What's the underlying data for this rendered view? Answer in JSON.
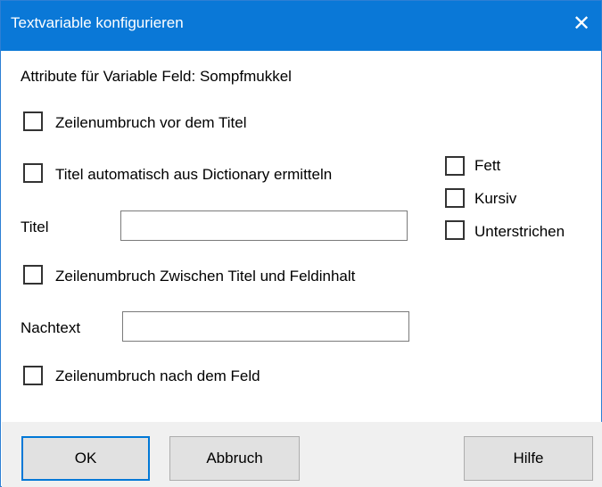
{
  "window": {
    "title": "Textvariable konfigurieren",
    "close_glyph": "✕",
    "colors": {
      "titlebar": "#0a78d7",
      "footer": "#f0f0f0",
      "accent": "#0078d7"
    }
  },
  "header": {
    "attribute_label": "Attribute für Variable Feld: Sompfmukkel"
  },
  "options": {
    "line_break_before_title": {
      "label": "Zeilenumbruch vor dem Titel",
      "checked": false
    },
    "auto_title_dictionary": {
      "label": "Titel automatisch aus Dictionary ermitteln",
      "checked": false
    },
    "line_break_between": {
      "label": "Zeilenumbruch Zwischen Titel und Feldinhalt",
      "checked": false
    },
    "line_break_after_field": {
      "label": "Zeilenumbruch nach dem Feld",
      "checked": false
    }
  },
  "style": {
    "bold": {
      "label": "Fett",
      "checked": false
    },
    "italic": {
      "label": "Kursiv",
      "checked": false
    },
    "underline": {
      "label": "Unterstrichen",
      "checked": false
    }
  },
  "fields": {
    "title_label": "Titel",
    "title_value": "",
    "posttext_label": "Nachtext",
    "posttext_value": ""
  },
  "buttons": {
    "ok": "OK",
    "cancel": "Abbruch",
    "help": "Hilfe"
  }
}
